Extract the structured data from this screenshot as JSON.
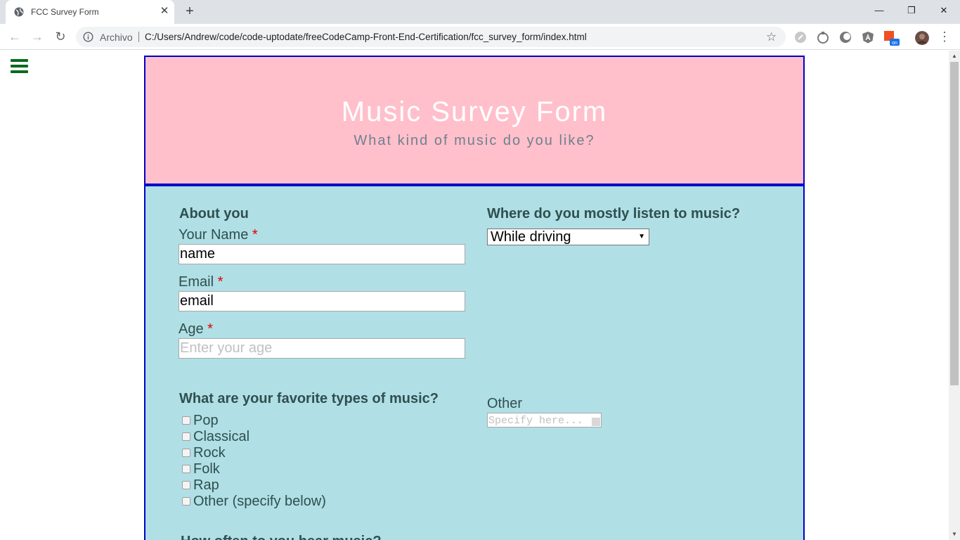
{
  "browser": {
    "tab_title": "FCC Survey Form",
    "tab_close": "✕",
    "new_tab": "+",
    "window": {
      "minimize": "—",
      "restore": "❐",
      "close": "✕"
    },
    "omnibox": {
      "chip": "Archivo",
      "url": "C:/Users/Andrew/code/code-uptodate/freeCodeCamp-Front-End-Certification/fcc_survey_form/index.html"
    },
    "nav": {
      "back": "←",
      "forward": "→",
      "reload": "↻",
      "star": "☆",
      "menu": "⋮"
    },
    "extensions": [
      "extension-icon",
      "extension-icon",
      "dark-mode-icon",
      "angular-icon",
      "extension-on-icon",
      "profile-avatar"
    ]
  },
  "page": {
    "menu_icon": "hamburger-menu-icon",
    "header": {
      "title": "Music Survey Form",
      "subtitle": "What kind of music do you like?"
    },
    "about": {
      "heading": "About you",
      "name_label": "Your Name",
      "name_value": "name",
      "email_label": "Email",
      "email_value": "email",
      "age_label": "Age",
      "age_placeholder": "Enter your age",
      "required_mark": "*"
    },
    "listen": {
      "heading": "Where do you mostly listen to music?",
      "selected": "While driving",
      "arrow": "▼"
    },
    "favorites": {
      "heading": "What are your favorite types of music?",
      "options": [
        "Pop",
        "Classical",
        "Rock",
        "Folk",
        "Rap",
        "Other (specify below)"
      ]
    },
    "other": {
      "label": "Other",
      "placeholder": "Specify here..."
    },
    "next_heading": "How often to you hear music?"
  },
  "colors": {
    "header_bg": "#ffc0cb",
    "form_bg": "#b0dfe5",
    "border": "#0000cc",
    "text": "#2f4f4f",
    "required": "#e00000",
    "menu_icon": "#0a6b1e"
  }
}
